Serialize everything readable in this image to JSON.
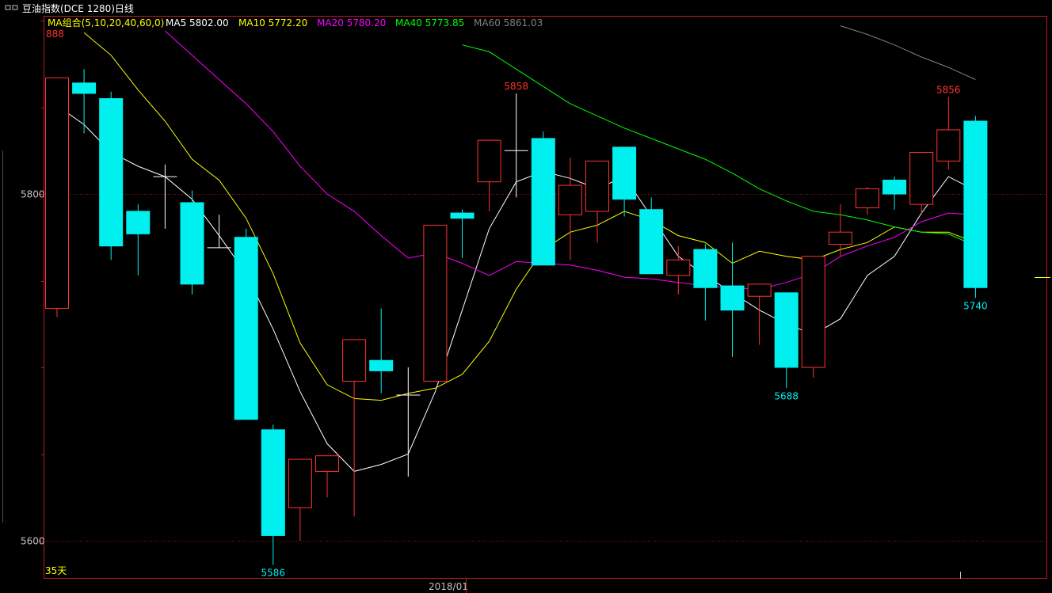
{
  "header": {
    "icon": "window-toggle-icon",
    "title": "豆油指数(DCE 1280)日线"
  },
  "ma_legend": {
    "group_label": "MA组合(5,10,20,40,60,0)",
    "items": [
      {
        "label": "MA5 5802.00",
        "color": "#ffffff"
      },
      {
        "label": "MA10 5772.20",
        "color": "#ffff00"
      },
      {
        "label": "MA20 5780.20",
        "color": "#ff00ff"
      },
      {
        "label": "MA40 5773.85",
        "color": "#00ff00"
      },
      {
        "label": "MA60 5861.03",
        "color": "#808080"
      }
    ]
  },
  "period_label": "35天",
  "x_date_label": "2018/01",
  "colors": {
    "up": "#ff3232",
    "down": "#00f0f0",
    "flat": "#ffffff",
    "frame": "#b41e1e",
    "grid": "#8b1a1a",
    "axis_text": "#c0c0c0",
    "group_label": "#ffff00"
  },
  "chart_data": {
    "type": "candlestick",
    "y_ticks": [
      5800,
      5600
    ],
    "ylim": [
      5584,
      5892
    ],
    "top_cut_label": "888",
    "candles": [
      {
        "o": 5734,
        "h": 5864,
        "l": 5729,
        "c": 5867
      },
      {
        "o": 5864,
        "h": 5872,
        "l": 5835,
        "c": 5858
      },
      {
        "o": 5855,
        "h": 5859,
        "l": 5762,
        "c": 5770
      },
      {
        "o": 5790,
        "h": 5794,
        "l": 5753,
        "c": 5777
      },
      {
        "o": 5810,
        "h": 5817,
        "l": 5780,
        "c": 5810
      },
      {
        "o": 5795,
        "h": 5802,
        "l": 5742,
        "c": 5748
      },
      {
        "o": 5769,
        "h": 5788,
        "l": 5769,
        "c": 5769
      },
      {
        "o": 5775,
        "h": 5780,
        "l": 5670,
        "c": 5670
      },
      {
        "o": 5664,
        "h": 5667,
        "l": 5586,
        "c": 5603
      },
      {
        "o": 5619,
        "h": 5637,
        "l": 5600,
        "c": 5647
      },
      {
        "o": 5640,
        "h": 5649,
        "l": 5625,
        "c": 5649
      },
      {
        "o": 5692,
        "h": 5704,
        "l": 5614,
        "c": 5716
      },
      {
        "o": 5704,
        "h": 5734,
        "l": 5685,
        "c": 5698
      },
      {
        "o": 5684,
        "h": 5700,
        "l": 5637,
        "c": 5684
      },
      {
        "o": 5692,
        "h": 5751,
        "l": 5692,
        "c": 5782
      },
      {
        "o": 5789,
        "h": 5791,
        "l": 5763,
        "c": 5786
      },
      {
        "o": 5807,
        "h": 5831,
        "l": 5790,
        "c": 5831
      },
      {
        "o": 5825,
        "h": 5858,
        "l": 5798,
        "c": 5825
      },
      {
        "o": 5832,
        "h": 5836,
        "l": 5776,
        "c": 5759
      },
      {
        "o": 5788,
        "h": 5821,
        "l": 5762,
        "c": 5805
      },
      {
        "o": 5790,
        "h": 5809,
        "l": 5772,
        "c": 5819
      },
      {
        "o": 5827,
        "h": 5827,
        "l": 5787,
        "c": 5797
      },
      {
        "o": 5791,
        "h": 5798,
        "l": 5758,
        "c": 5754
      },
      {
        "o": 5753,
        "h": 5770,
        "l": 5742,
        "c": 5762
      },
      {
        "o": 5768,
        "h": 5771,
        "l": 5727,
        "c": 5746
      },
      {
        "o": 5747,
        "h": 5772,
        "l": 5706,
        "c": 5733
      },
      {
        "o": 5741,
        "h": 5735,
        "l": 5713,
        "c": 5748
      },
      {
        "o": 5743,
        "h": 5742,
        "l": 5688,
        "c": 5700
      },
      {
        "o": 5700,
        "h": 5698,
        "l": 5694,
        "c": 5764
      },
      {
        "o": 5771,
        "h": 5794,
        "l": 5764,
        "c": 5778
      },
      {
        "o": 5792,
        "h": 5804,
        "l": 5788,
        "c": 5803
      },
      {
        "o": 5808,
        "h": 5810,
        "l": 5791,
        "c": 5800
      },
      {
        "o": 5794,
        "h": 5806,
        "l": 5788,
        "c": 5824
      },
      {
        "o": 5819,
        "h": 5856,
        "l": 5814,
        "c": 5837
      },
      {
        "o": 5842,
        "h": 5845,
        "l": 5740,
        "c": 5746
      }
    ],
    "annotations": [
      {
        "label": "5858",
        "value": 5858,
        "kind": "high"
      },
      {
        "label": "5856",
        "value": 5856,
        "kind": "high"
      },
      {
        "label": "5586",
        "value": 5586,
        "kind": "low"
      },
      {
        "label": "5688",
        "value": 5688,
        "kind": "low"
      },
      {
        "label": "5740",
        "value": 5740,
        "kind": "low"
      }
    ],
    "series": [
      {
        "name": "MA5",
        "color": "#ffffff",
        "values": [
          5851,
          5840,
          5824,
          5816,
          5810,
          5797,
          5776,
          5754,
          5722,
          5686,
          5656,
          5640,
          5644,
          5650,
          5686,
          5733,
          5780,
          5807,
          5813,
          5809,
          5803,
          5810,
          5787,
          5764,
          5753,
          5743,
          5733,
          5725,
          5719,
          5728,
          5753,
          5764,
          5789,
          5810,
          5802
        ]
      },
      {
        "name": "MA10",
        "color": "#ffff00",
        "values": [
          null,
          5893,
          5880,
          5860,
          5842,
          5820,
          5808,
          5786,
          5754,
          5714,
          5690,
          5682,
          5681,
          5685,
          5688,
          5696,
          5715,
          5745,
          5768,
          5778,
          5782,
          5790,
          5785,
          5776,
          5772,
          5760,
          5767,
          5764,
          5762,
          5768,
          5772,
          5781,
          5778,
          5778,
          5772
        ]
      },
      {
        "name": "MA20",
        "color": "#ff00ff",
        "values": [
          null,
          null,
          null,
          null,
          5894,
          5880,
          5866,
          5852,
          5836,
          5816,
          5800,
          5790,
          5776,
          5763,
          5766,
          5760,
          5753,
          5761,
          5760,
          5759,
          5756,
          5752,
          5751,
          5749,
          5747,
          5746,
          5745,
          5749,
          5754,
          5764,
          5770,
          5775,
          5784,
          5789,
          5788
        ]
      },
      {
        "name": "MA40",
        "color": "#00ff00",
        "values": [
          null,
          null,
          null,
          null,
          null,
          null,
          null,
          null,
          null,
          null,
          null,
          null,
          null,
          null,
          null,
          5886,
          5882,
          5872,
          5862,
          5852,
          5845,
          5838,
          5832,
          5826,
          5820,
          5812,
          5803,
          5796,
          5790,
          5788,
          5785,
          5781,
          5778,
          5777,
          5770
        ]
      },
      {
        "name": "MA60",
        "color": "#808080",
        "values": [
          null,
          null,
          null,
          null,
          null,
          null,
          null,
          null,
          null,
          null,
          null,
          null,
          null,
          null,
          null,
          null,
          null,
          null,
          null,
          null,
          null,
          null,
          null,
          null,
          null,
          null,
          null,
          null,
          null,
          5897,
          5892,
          5886,
          5879,
          5873,
          5866
        ]
      }
    ]
  }
}
